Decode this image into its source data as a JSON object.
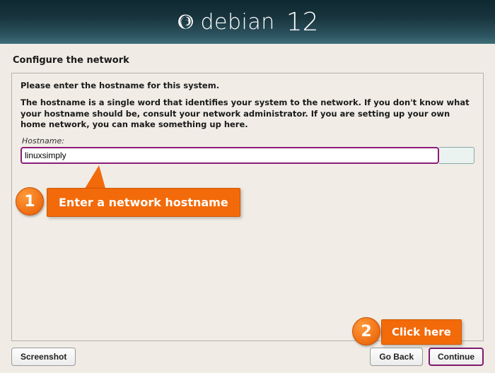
{
  "header": {
    "brand": "debian",
    "version": "12"
  },
  "section_title": "Configure the network",
  "panel": {
    "prompt": "Please enter the hostname for this system.",
    "description": "The hostname is a single word that identifies your system to the network. If you don't know what your hostname should be, consult your network administrator. If you are setting up your own home network, you can make something up here.",
    "hostname_label": "Hostname:",
    "hostname_value": "linuxsimply"
  },
  "buttons": {
    "screenshot": "Screenshot",
    "go_back": "Go Back",
    "continue": "Continue"
  },
  "annotations": {
    "step1_num": "1",
    "step1_text": "Enter a network hostname",
    "step2_num": "2",
    "step2_text": "Click here"
  }
}
